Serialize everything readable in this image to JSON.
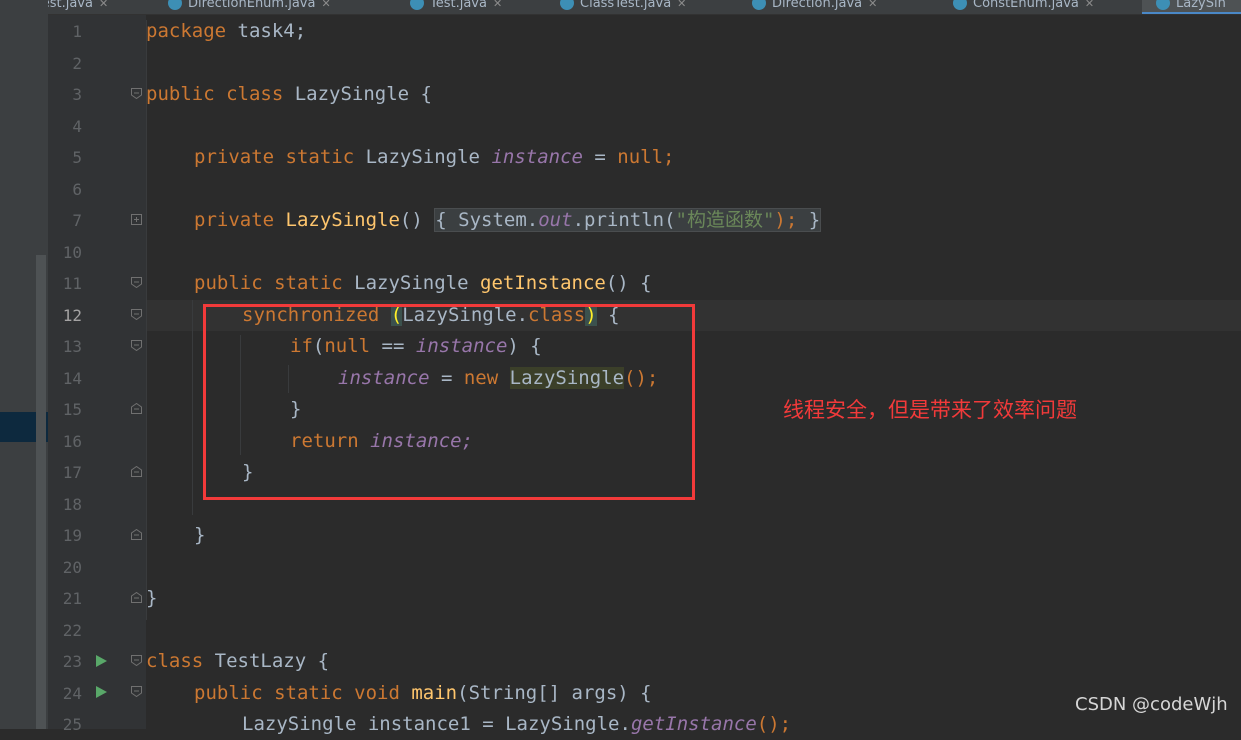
{
  "tabs": [
    {
      "label": "Test.java"
    },
    {
      "label": "DirectionEnum.java"
    },
    {
      "label": "Test.java"
    },
    {
      "label": "ClassTest.java"
    },
    {
      "label": "Direction.java"
    },
    {
      "label": "ConstEnum.java"
    },
    {
      "label": "LazySin"
    }
  ],
  "line_numbers": [
    "1",
    "2",
    "3",
    "4",
    "5",
    "6",
    "7",
    "10",
    "11",
    "12",
    "13",
    "14",
    "15",
    "16",
    "17",
    "18",
    "19",
    "20",
    "21",
    "22",
    "23",
    "24",
    "25"
  ],
  "code": {
    "l1_kw": "package",
    "l1_rest": " task4;",
    "l3_kw": "public class",
    "l3_rest": " LazySingle {",
    "l5_kw": "private static",
    "l5_type": " LazySingle ",
    "l5_field": "instance",
    "l5_eq": " = ",
    "l5_null": "null;",
    "l7_kw": "private",
    "l7_fn": " LazySingle",
    "l7_paren": "()",
    "l7_lb": "{",
    "l7_sys": " System.",
    "l7_out": "out",
    "l7_println": ".println(",
    "l7_str": "\"构造函数\"",
    "l7_close": ");",
    "l7_rb": "}",
    "l11_kw": "public static",
    "l11_type": " LazySingle ",
    "l11_fn": "getInstance",
    "l11_rest": "() {",
    "l12_kw": "synchronized",
    "l12_sp": " ",
    "l12_lp": "(",
    "l12_cls": "LazySingle.",
    "l12_class": "class",
    "l12_rp": ")",
    "l12_rest": " {",
    "l13_if": "if",
    "l13_lp": "(",
    "l13_null": "null",
    "l13_eq": " == ",
    "l13_field": "instance",
    "l13_rest": ") {",
    "l14_field": "instance",
    "l14_eq": " = ",
    "l14_new": "new",
    "l14_sp": " ",
    "l14_cls": "LazySingle",
    "l14_rest": "();",
    "l15_rb": "}",
    "l16_ret": "return",
    "l16_sp": " ",
    "l16_field": "instance;",
    "l17_rb": "}",
    "l19_rb": "}",
    "l21_rb": "}",
    "l23_kw": "class",
    "l23_rest": " TestLazy {",
    "l24_kw": "public static void",
    "l24_sp": " ",
    "l24_fn": "main",
    "l24_rest": "(String[] args) {",
    "l25_pre": "LazySingle instance1 = LazySingle.",
    "l25_fn": "getInstance",
    "l25_rest": "();"
  },
  "annotation": "线程安全，但是带来了效率问题",
  "watermark": "CSDN @codeWjh",
  "colors": {
    "keyword": "#cc7832",
    "field": "#9876aa",
    "method": "#ffc66d",
    "string": "#6a8759",
    "annotation": "#f23a3a"
  },
  "icons": {
    "run": "run-triangle-icon",
    "fold": "fold-marker-icon",
    "tab": "java-class-icon"
  }
}
